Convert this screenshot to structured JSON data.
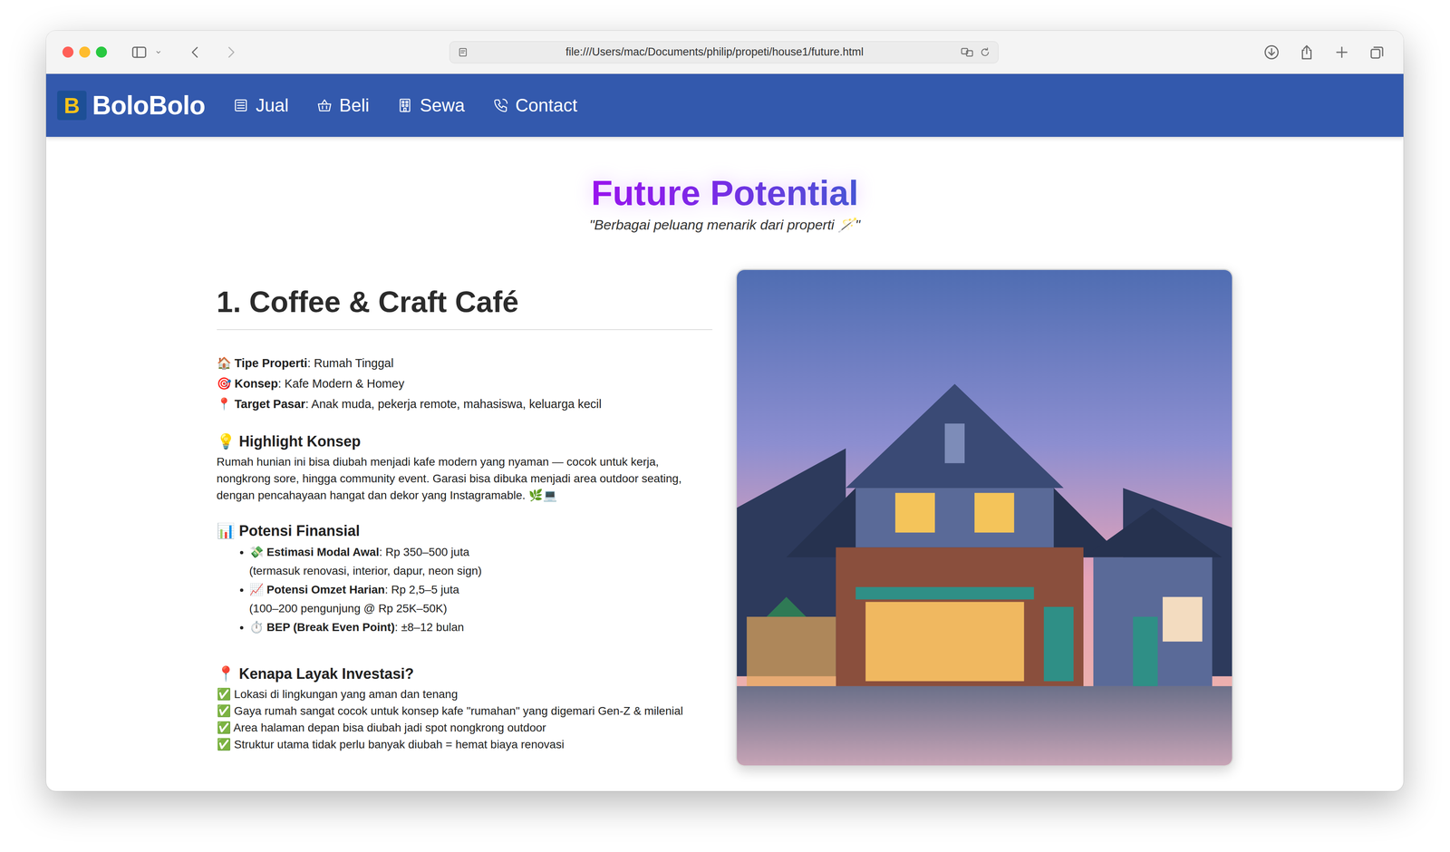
{
  "browser": {
    "url": "file:///Users/mac/Documents/philip/propeti/house1/future.html"
  },
  "nav": {
    "logo_letter": "B",
    "brand": "BoloBolo",
    "items": [
      {
        "label": "Jual"
      },
      {
        "label": "Beli"
      },
      {
        "label": "Sewa"
      },
      {
        "label": "Contact"
      }
    ]
  },
  "header": {
    "title": "Future Potential",
    "subtitle": "\"Berbagai peluang menarik dari properti 🪄\""
  },
  "section": {
    "heading": "1. Coffee & Craft Café",
    "facts": [
      {
        "icon": "🏠",
        "label": "Tipe Properti",
        "value": ": Rumah Tinggal"
      },
      {
        "icon": "🎯",
        "label": "Konsep",
        "value": ": Kafe Modern & Homey"
      },
      {
        "icon": "📍",
        "label": "Target Pasar",
        "value": ": Anak muda, pekerja remote, mahasiswa, keluarga kecil"
      }
    ],
    "highlight": {
      "icon": "💡",
      "heading": "Highlight Konsep",
      "text": "Rumah hunian ini bisa diubah menjadi kafe modern yang nyaman — cocok untuk kerja, nongkrong sore, hingga community event. Garasi bisa dibuka menjadi area outdoor seating, dengan pencahayaan hangat dan dekor yang Instagramable. 🌿💻"
    },
    "finance": {
      "icon": "📊",
      "heading": "Potensi Finansial",
      "items": [
        {
          "icon": "💸",
          "label": "Estimasi Modal Awal",
          "value": ": Rp 350–500 juta",
          "note": "(termasuk renovasi, interior, dapur, neon sign)"
        },
        {
          "icon": "📈",
          "label": "Potensi Omzet Harian",
          "value": ": Rp 2,5–5 juta",
          "note": "(100–200 pengunjung @ Rp 25K–50K)"
        },
        {
          "icon": "⏱️",
          "label": "BEP (Break Even Point)",
          "value": ": ±8–12 bulan",
          "note": ""
        }
      ]
    },
    "reasons": {
      "icon": "📍",
      "heading": "Kenapa Layak Investasi?",
      "items": [
        {
          "icon": "✅",
          "text": "Lokasi di lingkungan yang aman dan tenang"
        },
        {
          "icon": "✅",
          "text": "Gaya rumah sangat cocok untuk konsep kafe \"rumahan\" yang digemari Gen-Z & milenial"
        },
        {
          "icon": "✅",
          "text": "Area halaman depan bisa diubah jadi spot nongkrong outdoor"
        },
        {
          "icon": "✅",
          "text": "Struktur utama tidak perlu banyak diubah = hemat biaya renovasi"
        }
      ]
    }
  }
}
